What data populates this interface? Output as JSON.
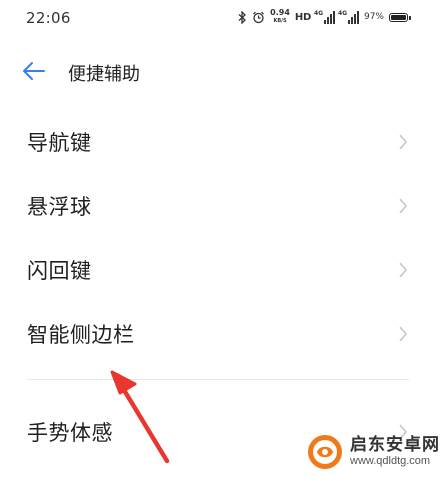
{
  "status_bar": {
    "time": "22:06",
    "net_speed_value": "0.94",
    "net_speed_unit": "KB/S",
    "hd_label": "HD",
    "sim1_label": "4G",
    "sim2_label": "4G",
    "battery_percent": "97%"
  },
  "header": {
    "title": "便捷辅助"
  },
  "settings": {
    "items": [
      {
        "label": "导航键"
      },
      {
        "label": "悬浮球"
      },
      {
        "label": "闪回键"
      },
      {
        "label": "智能侧边栏"
      }
    ],
    "gesture_label": "手势体感"
  },
  "watermark": {
    "name": "启东安卓网",
    "url": "www.qdldtg.com"
  },
  "colors": {
    "accent": "#3a7ff0",
    "annotation_arrow": "#e8372f",
    "watermark_orange": "#f07a1a"
  }
}
